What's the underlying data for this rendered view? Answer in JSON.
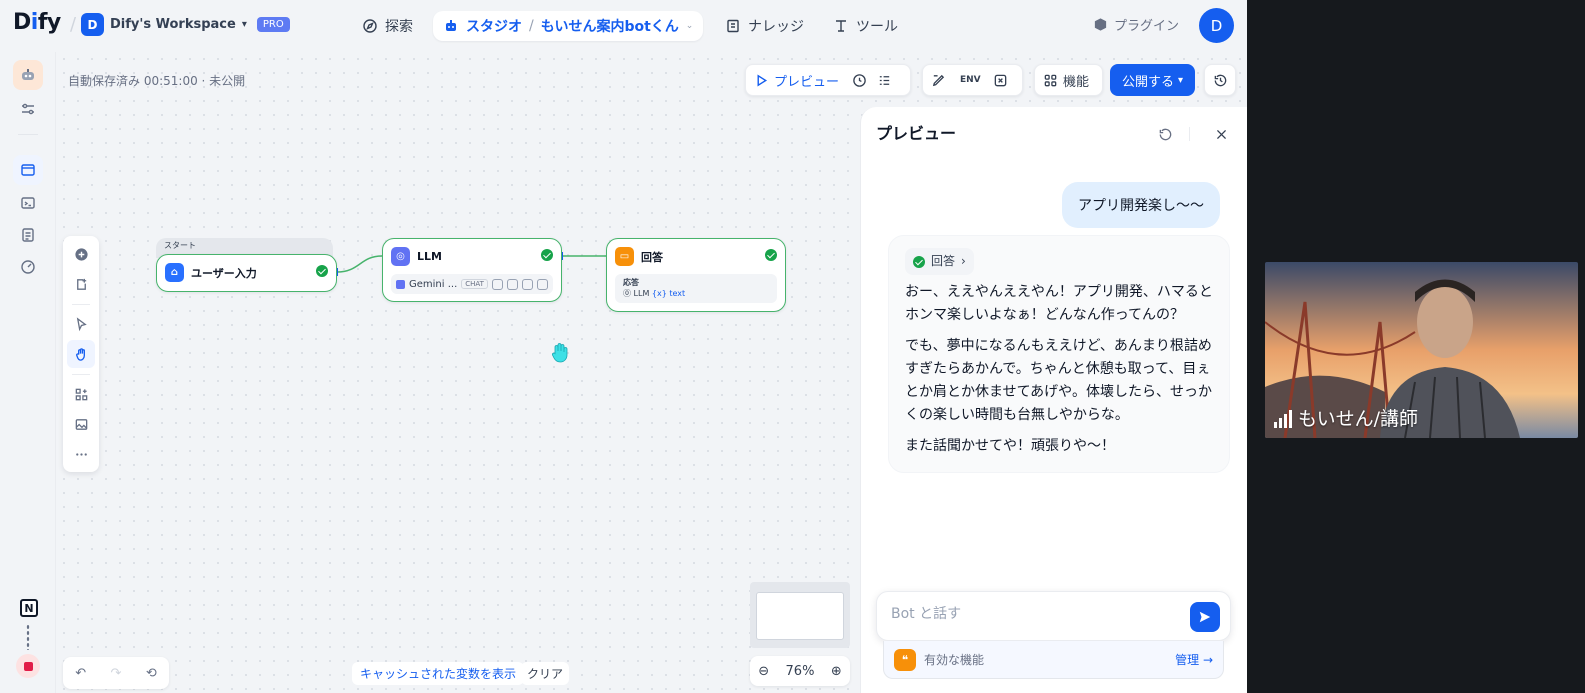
{
  "app": {
    "logo": "Dify",
    "workspace_initial": "D",
    "workspace_name": "Dify's Workspace",
    "plan_badge": "PRO",
    "user_initial": "D"
  },
  "nav": {
    "explore": "探索",
    "studio": "スタジオ",
    "app_name": "もいせん案内botくん",
    "knowledge": "ナレッジ",
    "tools": "ツール",
    "plugins": "プラグイン"
  },
  "canvas": {
    "autosave": "自動保存済み 00:51:00 · 未公開",
    "preview_button": "プレビュー",
    "features_button": "機能",
    "publish_button": "公開する",
    "env_label": "ENV",
    "cache_button": "キャッシュされた変数を表示",
    "clear_button": "クリア",
    "zoom": "76%"
  },
  "nodes": {
    "start_tag": "スタート",
    "start_title": "ユーザー入力",
    "llm_title": "LLM",
    "llm_model": "Gemini ...",
    "llm_mode": "CHAT",
    "answer_title": "回答",
    "answer_label": "応答",
    "answer_source": "LLM",
    "answer_var": "{x} text"
  },
  "preview": {
    "title": "プレビュー",
    "user_message": "アプリ開発楽し〜〜",
    "workflow_chip": "回答",
    "bot_paragraphs": [
      "おー、ええやんええやん！アプリ開発、ハマるとホンマ楽しいよなぁ！どんなん作ってんの？",
      "でも、夢中になるんもええけど、あんまり根詰めすぎたらあかんで。ちゃんと休憩も取って、目ぇとか肩とか休ませてあげや。体壊したら、せっかくの楽しい時間も台無しやからな。",
      "また話聞かせてや！頑張りや〜！"
    ],
    "input_placeholder": "Bot と話す",
    "features_label": "有効な機能",
    "manage_label": "管理"
  },
  "video": {
    "participant_name": "もいせん/講師"
  },
  "colors": {
    "accent": "#155eef",
    "success": "#17a34a",
    "answer_node": "#f79009",
    "llm_node": "#6172f3"
  }
}
